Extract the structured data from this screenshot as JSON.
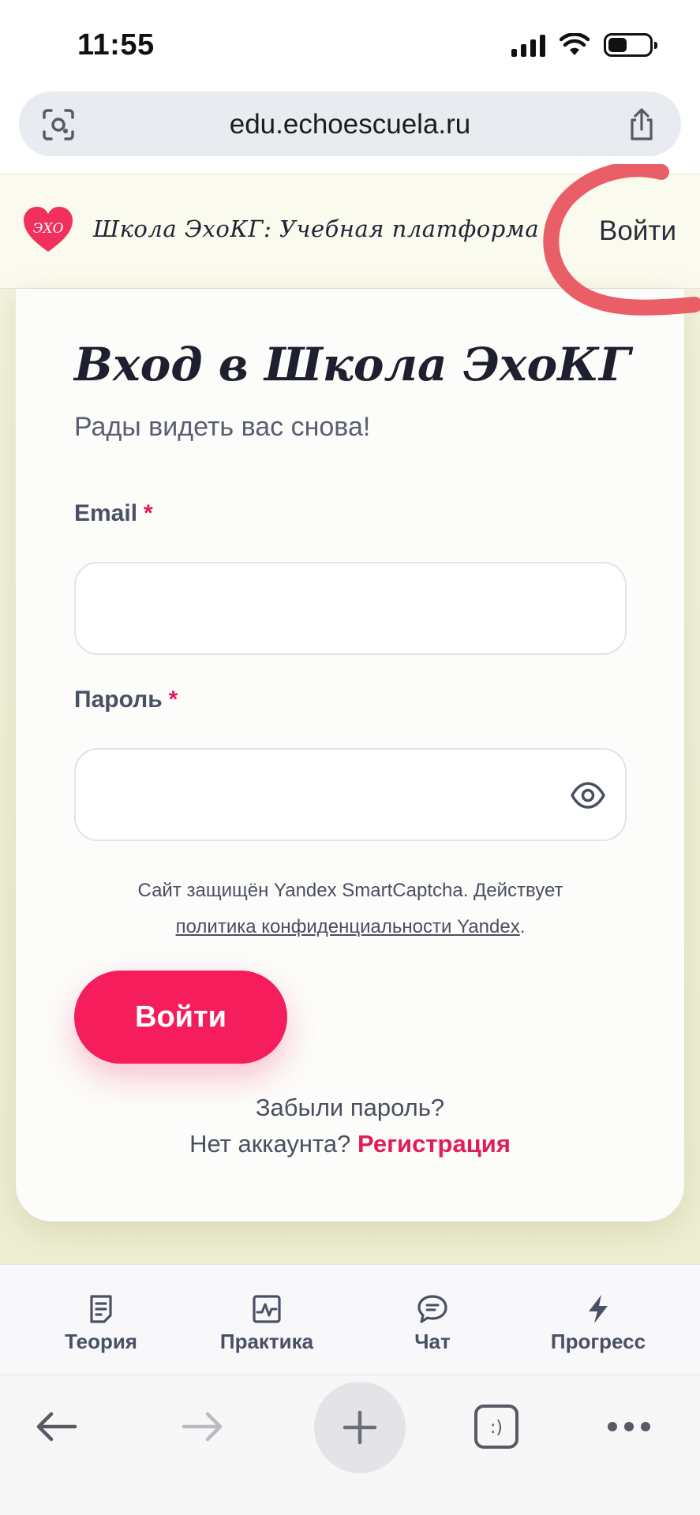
{
  "status_bar": {
    "time": "11:55"
  },
  "browser": {
    "url": "edu.echoescuela.ru"
  },
  "header": {
    "logo_text": "ЭХО",
    "brand_title": "Школа ЭхоКГ: Учебная платформа",
    "login_link": "Войти"
  },
  "login_card": {
    "title": "Вход в Школа ЭхоКГ",
    "subtitle": "Рады видеть вас снова!",
    "email_label": "Email",
    "password_label": "Пароль",
    "required_marker": "*",
    "email_value": "",
    "password_value": "",
    "captcha_text": "Сайт защищён Yandex SmartCaptcha. Действует",
    "captcha_link": "политика конфиденциальности Yandex",
    "captcha_period": ".",
    "submit_label": "Войти",
    "forgot_password": "Забыли пароль?",
    "no_account": "Нет аккаунта?",
    "register_link": "Регистрация"
  },
  "bottom_nav": {
    "items": [
      {
        "label": "Теория",
        "icon": "document-icon"
      },
      {
        "label": "Практика",
        "icon": "pulse-chart-icon"
      },
      {
        "label": "Чат",
        "icon": "chat-bubble-icon"
      },
      {
        "label": "Прогресс",
        "icon": "lightning-icon"
      }
    ]
  },
  "colors": {
    "accent": "#f51d5b",
    "header_bg": "#fafaee",
    "annotation_red": "#e8505b"
  }
}
